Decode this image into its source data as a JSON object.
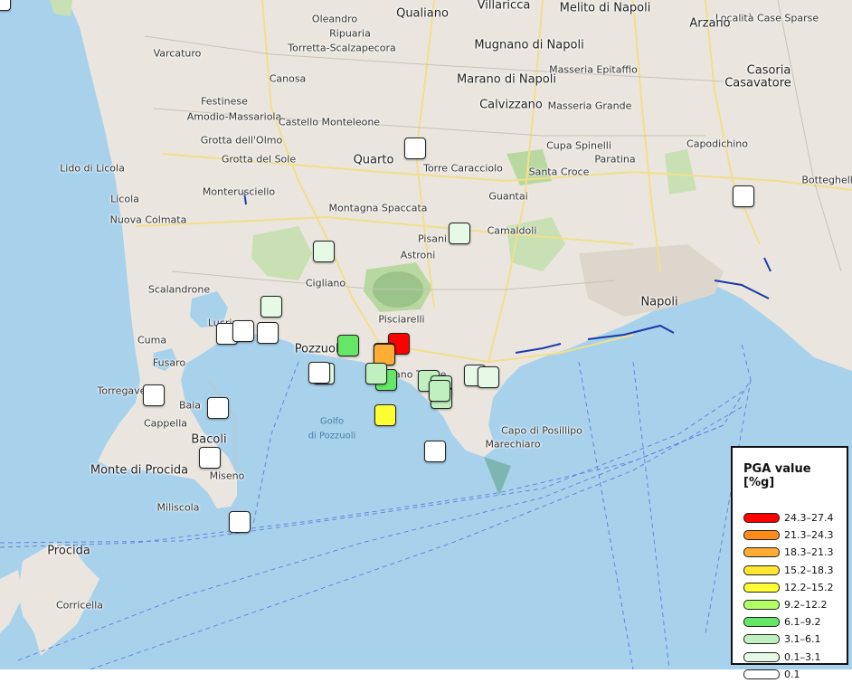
{
  "map": {
    "place_labels": [
      {
        "name": "Qualiano",
        "big": true
      },
      {
        "name": "Villaricca",
        "big": true
      },
      {
        "name": "Melito di Napoli",
        "big": true
      },
      {
        "name": "Località Case Sparse",
        "big": false
      },
      {
        "name": "Oleandro",
        "big": false
      },
      {
        "name": "Ripuaria",
        "big": false
      },
      {
        "name": "Torretta-Scalzapecora",
        "big": false
      },
      {
        "name": "Mugnano di Napoli",
        "big": true
      },
      {
        "name": "Arzano",
        "big": true
      },
      {
        "name": "Varcaturo",
        "big": false
      },
      {
        "name": "Canosa",
        "big": false
      },
      {
        "name": "Marano di Napoli",
        "big": true
      },
      {
        "name": "Masseria Epitaffio",
        "big": false
      },
      {
        "name": "Casoria",
        "big": true
      },
      {
        "name": "Casavatore",
        "big": true
      },
      {
        "name": "Festinese",
        "big": false
      },
      {
        "name": "Amodio-Massariola",
        "big": false
      },
      {
        "name": "Calvizzano",
        "big": true
      },
      {
        "name": "Masseria Grande",
        "big": false
      },
      {
        "name": "Castello Monteleone",
        "big": false
      },
      {
        "name": "Grotta dell'Olmo",
        "big": false
      },
      {
        "name": "Capodichino",
        "big": false
      },
      {
        "name": "Cupa Spinelli",
        "big": false
      },
      {
        "name": "Grotta del Sole",
        "big": false
      },
      {
        "name": "Quarto",
        "big": true
      },
      {
        "name": "Paratina",
        "big": false
      },
      {
        "name": "Lido di Licola",
        "big": false
      },
      {
        "name": "Torre Caracciolo",
        "big": false
      },
      {
        "name": "Santa Croce",
        "big": false
      },
      {
        "name": "Botteghelle",
        "big": false
      },
      {
        "name": "Monterusciello",
        "big": false
      },
      {
        "name": "Licola",
        "big": false
      },
      {
        "name": "Montagna Spaccata",
        "big": false
      },
      {
        "name": "Guantai",
        "big": false
      },
      {
        "name": "Nuova Colmata",
        "big": false
      },
      {
        "name": "Camaldoli",
        "big": false
      },
      {
        "name": "Pisani",
        "big": false
      },
      {
        "name": "Astroni",
        "big": false
      },
      {
        "name": "Cigliano",
        "big": false
      },
      {
        "name": "Scalandrone",
        "big": false
      },
      {
        "name": "Napoli",
        "big": true
      },
      {
        "name": "Lucrino",
        "big": false
      },
      {
        "name": "Pisciarelli",
        "big": false
      },
      {
        "name": "Cuma",
        "big": false
      },
      {
        "name": "Pozzuoli",
        "big": true
      },
      {
        "name": "Fusaro",
        "big": false
      },
      {
        "name": "Torregaveta",
        "big": false
      },
      {
        "name": "Agnano Terme",
        "big": false
      },
      {
        "name": "Baia",
        "big": false
      },
      {
        "name": "Cappella",
        "big": false
      },
      {
        "name": "Capo di Posillipo",
        "big": false
      },
      {
        "name": "Bacoli",
        "big": true
      },
      {
        "name": "Marechiaro",
        "big": false
      },
      {
        "name": "Monte di Procida",
        "big": true
      },
      {
        "name": "Miseno",
        "big": false
      },
      {
        "name": "Miliscola",
        "big": false
      },
      {
        "name": "Procida",
        "big": true
      },
      {
        "name": "Corricella",
        "big": false
      }
    ],
    "water_labels": [
      "Golfo",
      "di Pozzuoli"
    ],
    "colors": {
      "sea": "#a8d2ec",
      "land": "#eae6df",
      "park": "#c8e0b4",
      "route": "#1a3aa8"
    }
  },
  "stations": [
    {
      "pga_class": "24.3–27.4",
      "color": "#ff0000"
    },
    {
      "pga_class": "21.3–24.3",
      "color": "#ff8c1a"
    },
    {
      "pga_class": "18.3–21.3",
      "color": "#ffad33"
    },
    {
      "pga_class": "12.2–15.2",
      "color": "#ffff33"
    },
    {
      "pga_class": "6.1–9.2",
      "color": "#66e666"
    },
    {
      "pga_class": "6.1–9.2",
      "color": "#66e666"
    },
    {
      "pga_class": "3.1–6.1",
      "color": "#c0f0c0"
    },
    {
      "pga_class": "3.1–6.1",
      "color": "#c0f0c0"
    },
    {
      "pga_class": "3.1–6.1",
      "color": "#c0f0c0"
    },
    {
      "pga_class": "3.1–6.1",
      "color": "#c0f0c0"
    },
    {
      "pga_class": "3.1–6.1",
      "color": "#c0f0c0"
    },
    {
      "pga_class": "0.1–3.1",
      "color": "#e6f8e6"
    },
    {
      "pga_class": "0.1–3.1",
      "color": "#e6f8e6"
    },
    {
      "pga_class": "0.1–3.1",
      "color": "#e6f8e6"
    },
    {
      "pga_class": "0.1–3.1",
      "color": "#e6f8e6"
    },
    {
      "pga_class": "0.1–3.1",
      "color": "#e6f8e6"
    },
    {
      "pga_class": "0.1–3.1",
      "color": "#e6f8e6"
    },
    {
      "pga_class": "0.1",
      "color": "#ffffff"
    },
    {
      "pga_class": "0.1",
      "color": "#ffffff"
    },
    {
      "pga_class": "0.1",
      "color": "#ffffff"
    },
    {
      "pga_class": "0.1",
      "color": "#ffffff"
    },
    {
      "pga_class": "0.1",
      "color": "#ffffff"
    },
    {
      "pga_class": "0.1",
      "color": "#ffffff"
    },
    {
      "pga_class": "0.1",
      "color": "#ffffff"
    },
    {
      "pga_class": "0.1",
      "color": "#ffffff"
    },
    {
      "pga_class": "0.1",
      "color": "#ffffff"
    },
    {
      "pga_class": "0.1",
      "color": "#ffffff"
    },
    {
      "pga_class": "0.1",
      "color": "#ffffff"
    },
    {
      "pga_class": "0.1",
      "color": "#ffffff"
    }
  ],
  "legend": {
    "title": "PGA value [%g]",
    "items": [
      {
        "label": "24.3–27.4",
        "color": "#ff0000"
      },
      {
        "label": "21.3–24.3",
        "color": "#ff8c1a"
      },
      {
        "label": "18.3–21.3",
        "color": "#ffad33"
      },
      {
        "label": "15.2–18.3",
        "color": "#ffe633"
      },
      {
        "label": "12.2–15.2",
        "color": "#ffff33"
      },
      {
        "label": "9.2–12.2",
        "color": "#b3ff66"
      },
      {
        "label": "6.1–9.2",
        "color": "#66e666"
      },
      {
        "label": "3.1–6.1",
        "color": "#c0f0c0"
      },
      {
        "label": "0.1–3.1",
        "color": "#e6f8e6"
      },
      {
        "label": "0.1",
        "color": "#ffffff"
      }
    ]
  }
}
